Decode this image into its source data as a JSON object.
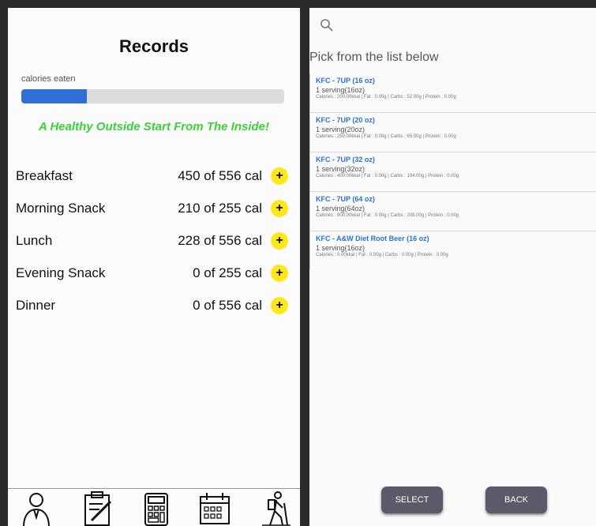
{
  "records": {
    "title": "Records",
    "calories_label": "calories eaten",
    "progress_fraction": 0.25,
    "slogan": "A Healthy Outside Start From The Inside!",
    "add_symbol": "+",
    "meals": [
      {
        "name": "Breakfast",
        "value": "450 of 556 cal"
      },
      {
        "name": "Morning Snack",
        "value": "210 of 255 cal"
      },
      {
        "name": "Lunch",
        "value": "228 of 556 cal"
      },
      {
        "name": "Evening Snack",
        "value": "0 of 255 cal"
      },
      {
        "name": "Dinner",
        "value": "0 of 556 cal"
      }
    ],
    "nav_icons": [
      "profile-icon",
      "clipboard-icon",
      "calculator-icon",
      "calendar-icon",
      "hiker-icon"
    ]
  },
  "food_picker": {
    "prompt": "Pick from the list below",
    "items": [
      {
        "name": "KFC - 7UP (16 oz)",
        "serving": "1 serving(16oz)",
        "info": "Calories : 200.00kkal | Fat : 0.00g | Carbs : 52.00g | Protein : 0.00g"
      },
      {
        "name": "KFC - 7UP (20 oz)",
        "serving": "1 serving(20oz)",
        "info": "Calories : 250.00kkal | Fat : 0.00g | Carbs : 65.00g | Protein : 0.00g"
      },
      {
        "name": "KFC - 7UP (32 oz)",
        "serving": "1 serving(32oz)",
        "info": "Calories : 400.00kkal | Fat : 0.00g | Carbs : 104.00g | Protein : 0.00g"
      },
      {
        "name": "KFC - 7UP (64 oz)",
        "serving": "1 serving(64oz)",
        "info": "Calories : 800.00kkal | Fat : 0.00g | Carbs : 208.00g | Protein : 0.00g"
      },
      {
        "name": "KFC - A&W Diet Root Beer (16 oz)",
        "serving": "1 serving(16oz)",
        "info": "Calories : 0.00kkal | Fat : 0.00g | Carbs : 0.00g | Protein : 0.00g"
      }
    ],
    "select_label": "SELECT",
    "back_label": "BACK"
  },
  "colors": {
    "accent_blue": "#2f6fd6",
    "slogan_green": "#3ad13a",
    "add_yellow": "#ffe71a",
    "item_blue": "#2a73c9"
  }
}
